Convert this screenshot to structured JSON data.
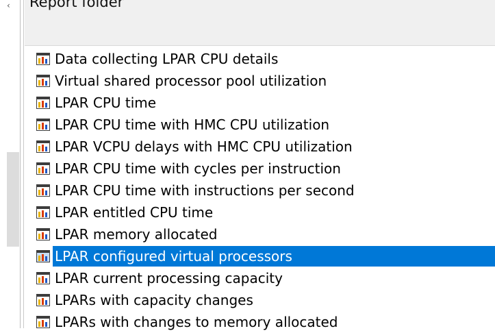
{
  "header": {
    "title": "Report folder"
  },
  "left_pane": {
    "arrow_glyph": "‹"
  },
  "report_list": {
    "selected_index": 9,
    "items": [
      {
        "label": "Data collecting LPAR CPU details",
        "icon": "chart-report-icon"
      },
      {
        "label": "Virtual shared processor pool utilization",
        "icon": "chart-report-icon"
      },
      {
        "label": "LPAR CPU time",
        "icon": "chart-report-icon"
      },
      {
        "label": "LPAR CPU time with HMC CPU utilization",
        "icon": "chart-report-icon"
      },
      {
        "label": "LPAR VCPU delays with HMC CPU utilization",
        "icon": "chart-report-icon"
      },
      {
        "label": "LPAR CPU time with cycles per instruction",
        "icon": "chart-report-icon"
      },
      {
        "label": "LPAR CPU time with instructions per second",
        "icon": "chart-report-icon"
      },
      {
        "label": "LPAR entitled CPU time",
        "icon": "chart-report-icon"
      },
      {
        "label": "LPAR memory allocated",
        "icon": "chart-report-icon"
      },
      {
        "label": "LPAR configured virtual processors",
        "icon": "chart-report-icon"
      },
      {
        "label": "LPAR current processing capacity",
        "icon": "chart-report-icon"
      },
      {
        "label": "LPARs with capacity changes",
        "icon": "chart-report-icon"
      },
      {
        "label": "LPARs with changes to memory allocated",
        "icon": "chart-report-icon"
      }
    ]
  },
  "colors": {
    "selection": "#0078d7",
    "icon_frame": "#3c3c3c",
    "icon_bar_yellow": "#e8b400",
    "icon_bar_red": "#d83b01",
    "icon_bar_blue": "#1f57c4"
  }
}
